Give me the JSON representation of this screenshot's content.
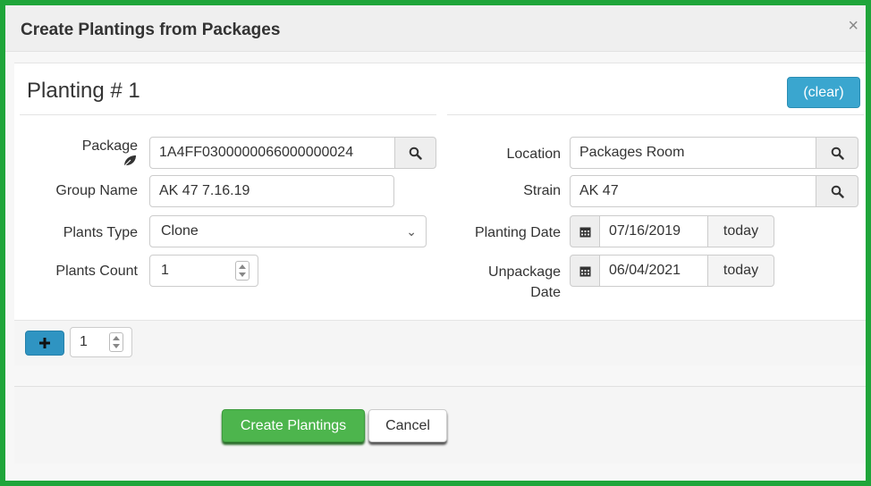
{
  "dialog": {
    "title": "Create Plantings from Packages",
    "close_glyph": "×"
  },
  "planting": {
    "heading": "Planting # 1",
    "clear_label": "(clear)"
  },
  "fields": {
    "package_label": "Package",
    "package_value": "1A4FF0300000066000000024",
    "group_name_label": "Group Name",
    "group_name_value": "AK 47 7.16.19",
    "plants_type_label": "Plants Type",
    "plants_type_value": "Clone",
    "plants_count_label": "Plants Count",
    "plants_count_value": "1",
    "location_label": "Location",
    "location_value": "Packages Room",
    "strain_label": "Strain",
    "strain_value": "AK 47",
    "planting_date_label": "Planting Date",
    "planting_date_value": "07/16/2019",
    "unpackage_label_line1": "Unpackage",
    "unpackage_label_line2": "Date",
    "unpackage_date_value": "06/04/2021",
    "today_label": "today"
  },
  "add_row": {
    "count_value": "1"
  },
  "footer": {
    "create_label": "Create Plantings",
    "cancel_label": "Cancel"
  },
  "icons": {
    "search": "search-icon",
    "calendar": "calendar-icon",
    "leaf": "leaf-icon",
    "plus": "plus-icon"
  },
  "colors": {
    "frame_border": "#1fa53a",
    "clear_button": "#3aa6cf",
    "create_button": "#4db54d",
    "plus_button": "#2f94c2"
  }
}
